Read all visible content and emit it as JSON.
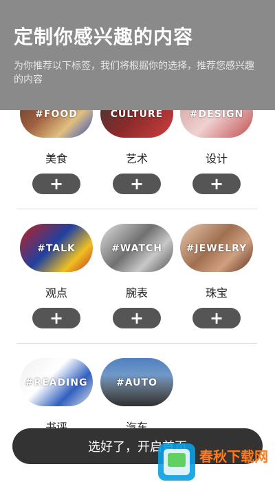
{
  "header": {
    "title": "定制你感兴趣的内容",
    "subtitle": "为你推荐以下标签，我们将根据你的选择，推荐您感兴趣的内容"
  },
  "categories": [
    {
      "tag": "#FOOD",
      "label": "美食",
      "icon": "plus-icon"
    },
    {
      "tag": "CULTURE",
      "label": "艺术",
      "icon": "plus-icon"
    },
    {
      "tag": "#DESIGN",
      "label": "设计",
      "icon": "plus-icon"
    },
    {
      "tag": "#TALK",
      "label": "观点",
      "icon": "plus-icon"
    },
    {
      "tag": "#WATCH",
      "label": "腕表",
      "icon": "plus-icon"
    },
    {
      "tag": "#JEWELRY",
      "label": "珠宝",
      "icon": "plus-icon"
    },
    {
      "tag": "#READING",
      "label": "书评",
      "icon": "plus-icon"
    },
    {
      "tag": "#AUTO",
      "label": "汽车",
      "icon": "plus-icon"
    }
  ],
  "cta": {
    "label": "选好了，开启首页"
  },
  "watermark": {
    "text": "春秋下载网",
    "url": "www.cdgthk.com"
  },
  "colors": {
    "header_bg": "#8a8a8a",
    "button_bg": "#555555",
    "cta_bg": "#333333"
  }
}
